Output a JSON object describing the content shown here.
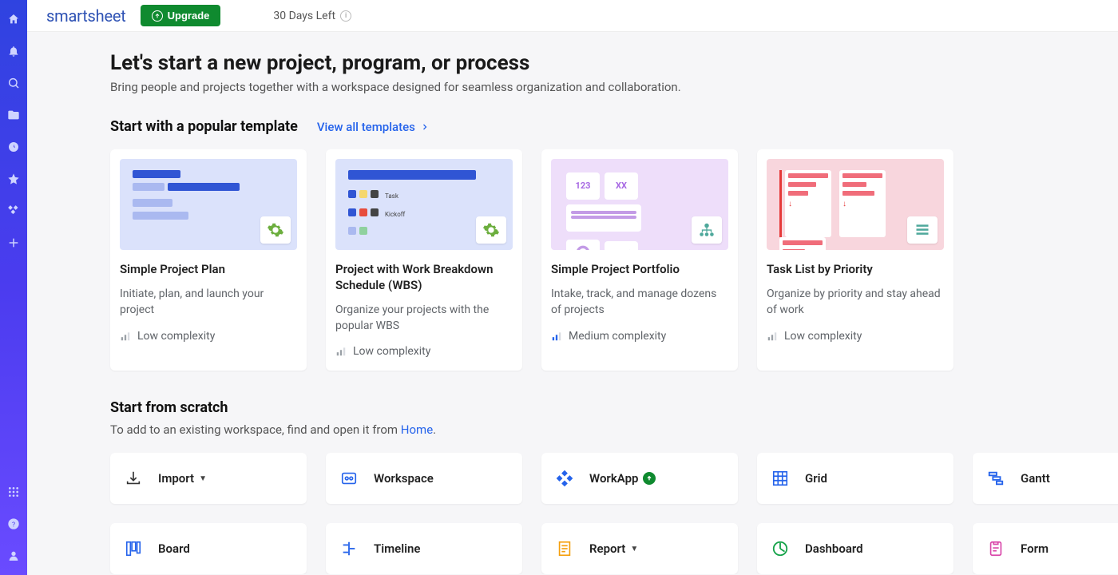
{
  "brand": "smartsheet",
  "header": {
    "upgrade_label": "Upgrade",
    "trial_label": "30 Days Left"
  },
  "page": {
    "title": "Let's start a new project, program, or process",
    "subtitle": "Bring people and projects together with a workspace designed for seamless organization and collaboration."
  },
  "templates_section": {
    "title": "Start with a popular template",
    "view_all": "View all templates"
  },
  "templates": [
    {
      "title": "Simple Project Plan",
      "desc": "Initiate, plan, and launch your project",
      "complexity": "Low complexity"
    },
    {
      "title": "Project with Work Breakdown Schedule (WBS)",
      "desc": "Organize your projects with the popular WBS",
      "complexity": "Low complexity"
    },
    {
      "title": "Simple Project Portfolio",
      "desc": "Intake, track, and manage dozens of projects",
      "complexity": "Medium complexity"
    },
    {
      "title": "Task List by Priority",
      "desc": "Organize by priority and stay ahead of work",
      "complexity": "Low complexity"
    }
  ],
  "scratch_section": {
    "title": "Start from scratch",
    "subtitle_pre": "To add to an existing workspace, find and open it from ",
    "subtitle_link": "Home",
    "subtitle_post": "."
  },
  "scratch": [
    {
      "label": "Import",
      "icon": "import",
      "has_caret": true,
      "has_pill": false
    },
    {
      "label": "Workspace",
      "icon": "workspace",
      "has_caret": false,
      "has_pill": false
    },
    {
      "label": "WorkApp",
      "icon": "workapp",
      "has_caret": false,
      "has_pill": true
    },
    {
      "label": "Grid",
      "icon": "grid",
      "has_caret": false,
      "has_pill": false
    },
    {
      "label": "Gantt",
      "icon": "gantt",
      "has_caret": false,
      "has_pill": false
    },
    {
      "label": "Board",
      "icon": "board",
      "has_caret": false,
      "has_pill": false
    },
    {
      "label": "Timeline",
      "icon": "timeline",
      "has_caret": false,
      "has_pill": false
    },
    {
      "label": "Report",
      "icon": "report",
      "has_caret": true,
      "has_pill": false
    },
    {
      "label": "Dashboard",
      "icon": "dashboard",
      "has_caret": false,
      "has_pill": false
    },
    {
      "label": "Form",
      "icon": "form",
      "has_caret": false,
      "has_pill": false
    }
  ]
}
